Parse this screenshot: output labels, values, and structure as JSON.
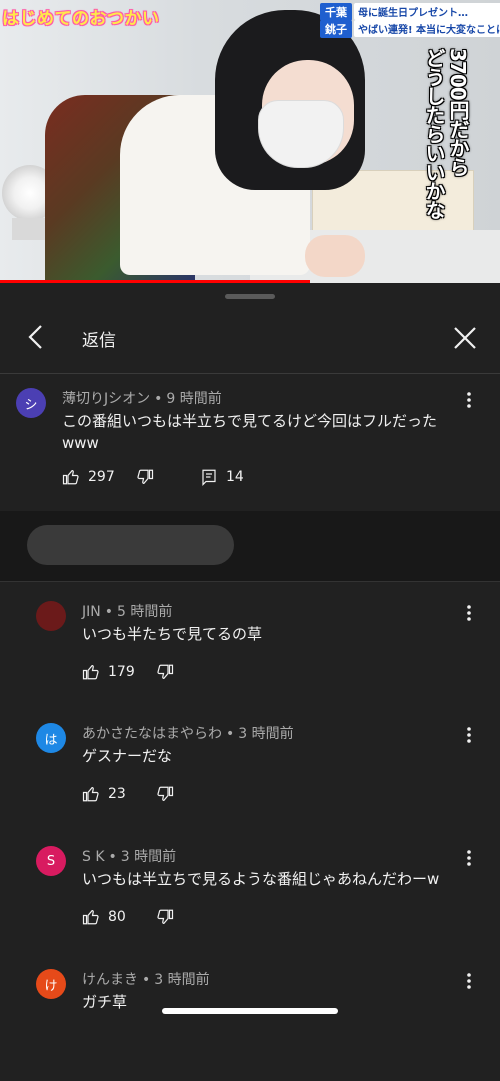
{
  "video": {
    "show_logo": "はじめてのおつかい",
    "tag_chiba": "千葉",
    "tag_choshi": "銚子",
    "headline_1": "母に誕生日プレゼント…",
    "headline_2": "やばい連発! 本当に大変なことに…",
    "caption_right": "3700円だから",
    "caption_left": "どうしたらいいかな",
    "progress_fraction": 0.62
  },
  "sheet": {
    "title": "返信"
  },
  "parent_comment": {
    "avatar_letter": "シ",
    "avatar_color": "#4b3fb3",
    "author": "薄切りJシオン",
    "time": "9 時間前",
    "text": "この番組いつもは半立ちで見てるけど今回はフルだったwww",
    "likes": "297",
    "replies": "14"
  },
  "replies": [
    {
      "avatar_letter": "",
      "avatar_color": "#6b1a1a",
      "author": "JIN",
      "time": "5 時間前",
      "text": "いつも半たちで見てるの草",
      "likes": "179"
    },
    {
      "avatar_letter": "は",
      "avatar_color": "#1e88e5",
      "author": "あかさたなはまやらわ",
      "time": "3 時間前",
      "text": "ゲスナーだな",
      "likes": "23"
    },
    {
      "avatar_letter": "S",
      "avatar_color": "#d81b60",
      "author": "S K",
      "time": "3 時間前",
      "text": "いつもは半立ちで見るような番組じゃあねんだわーw",
      "likes": "80"
    },
    {
      "avatar_letter": "け",
      "avatar_color": "#e64a19",
      "author": "けんまき",
      "time": "3 時間前",
      "text": "ガチ草",
      "likes": ""
    }
  ],
  "icons": {
    "like": "thumb-up-icon",
    "dislike": "thumb-down-icon",
    "reply": "reply-comment-icon",
    "more": "more-vert-icon",
    "back": "chevron-left-icon",
    "close": "close-icon"
  },
  "colors": {
    "background": "#212121",
    "progress": "#ff0000"
  }
}
